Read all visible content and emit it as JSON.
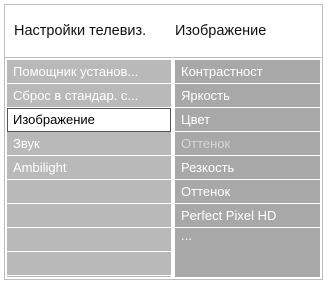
{
  "header": {
    "left_title": "Настройки телевиз.",
    "right_title": "Изображение"
  },
  "left_menu": {
    "items": [
      {
        "label": "Помощник установ..."
      },
      {
        "label": "Сброс в стандар. с..."
      },
      {
        "label": "Изображение",
        "selected": true
      },
      {
        "label": "Звук"
      },
      {
        "label": "Ambilight"
      }
    ]
  },
  "right_menu": {
    "items": [
      {
        "label": "Контрастност"
      },
      {
        "label": "Яркость"
      },
      {
        "label": "Цвет"
      },
      {
        "label": "Оттенок",
        "disabled": true
      },
      {
        "label": "Резкость"
      },
      {
        "label": "Оттенок"
      },
      {
        "label": "Perfect Pixel HD"
      }
    ],
    "more": "..."
  }
}
